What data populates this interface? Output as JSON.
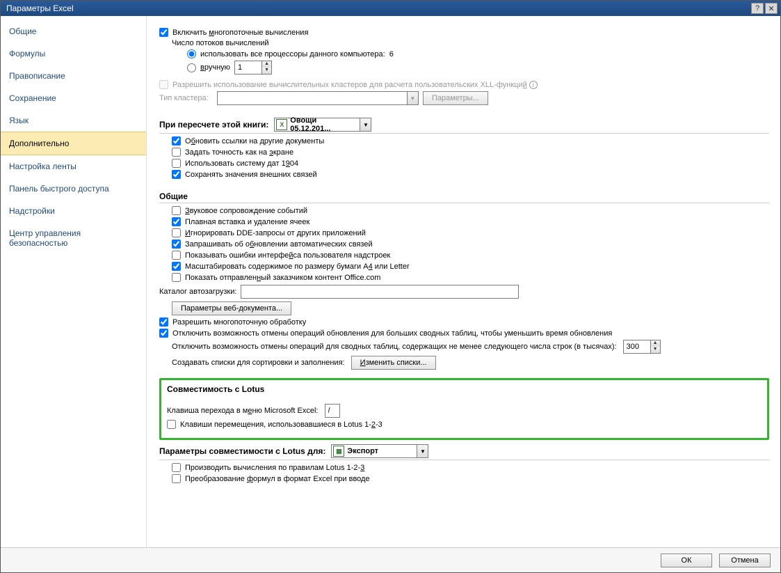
{
  "title": "Параметры Excel",
  "sidebar": {
    "items": [
      {
        "label": "Общие"
      },
      {
        "label": "Формулы"
      },
      {
        "label": "Правописание"
      },
      {
        "label": "Сохранение"
      },
      {
        "label": "Язык"
      },
      {
        "label": "Дополнительно",
        "selected": true
      },
      {
        "label": "Настройка ленты"
      },
      {
        "label": "Панель быстрого доступа"
      },
      {
        "label": "Надстройки"
      },
      {
        "label": "Центр управления безопасностью"
      }
    ]
  },
  "calc": {
    "enable_multithread": "Включить многопоточные вычисления",
    "threads_label": "Число потоков вычислений",
    "use_all": "использовать все процессоры данного компьютера:",
    "core_count": "6",
    "manual": "вручную",
    "manual_value": "1",
    "allow_clusters": "Разрешить использование вычислительных кластеров для расчета пользовательских XLL-функций",
    "cluster_type": "Тип кластера:",
    "cluster_params_btn": "Параметры..."
  },
  "recalc": {
    "heading": "При пересчете этой книги:",
    "book": "Овощи 05.12.201...",
    "update_links": "Обновить ссылки на другие документы",
    "precision": "Задать точность как на экране",
    "date1904": "Использовать систему дат 1904",
    "save_ext": "Сохранять значения внешних связей"
  },
  "general": {
    "heading": "Общие",
    "sound": "Звуковое сопровождение событий",
    "smooth_insert": "Плавная вставка и удаление ячеек",
    "ignore_dde": "Игнорировать DDE-запросы от других приложений",
    "ask_updates": "Запрашивать об обновлении автоматических связей",
    "addin_errors": "Показывать ошибки интерфейса пользователя надстроек",
    "scale_a4": "Масштабировать содержимое по размеру бумаги A4 или Letter",
    "office_content": "Показать отправленный заказчиком контент Office.com",
    "autoload": "Каталог автозагрузки:",
    "web_params_btn": "Параметры веб-документа...",
    "multi_proc": "Разрешить многопоточную обработку",
    "disable_undo_big": "Отключить возможность отмены операций обновления для больших сводных таблиц, чтобы уменьшить время обновления",
    "disable_undo_rows": "Отключить возможность отмены операций для сводных таблиц, содержащих не менее следующего числа строк (в тысячах):",
    "rows_value": "300",
    "sort_lists": "Создавать списки для сортировки и заполнения:",
    "edit_lists_btn": "Изменить списки..."
  },
  "lotus": {
    "heading": "Совместимость с Lotus",
    "menu_key": "Клавиша перехода в меню Microsoft Excel:",
    "menu_key_value": "/",
    "nav_keys": "Клавиши перемещения, использовавшиеся в Lotus 1-2-3"
  },
  "lotus_params": {
    "heading": "Параметры совместимости с Lotus для:",
    "sheet": "Экспорт",
    "calc_rule": "Производить вычисления по правилам Lotus 1-2-3",
    "formula_conv": "Преобразование формул в формат Excel при вводе"
  },
  "footer": {
    "ok": "ОК",
    "cancel": "Отмена"
  }
}
